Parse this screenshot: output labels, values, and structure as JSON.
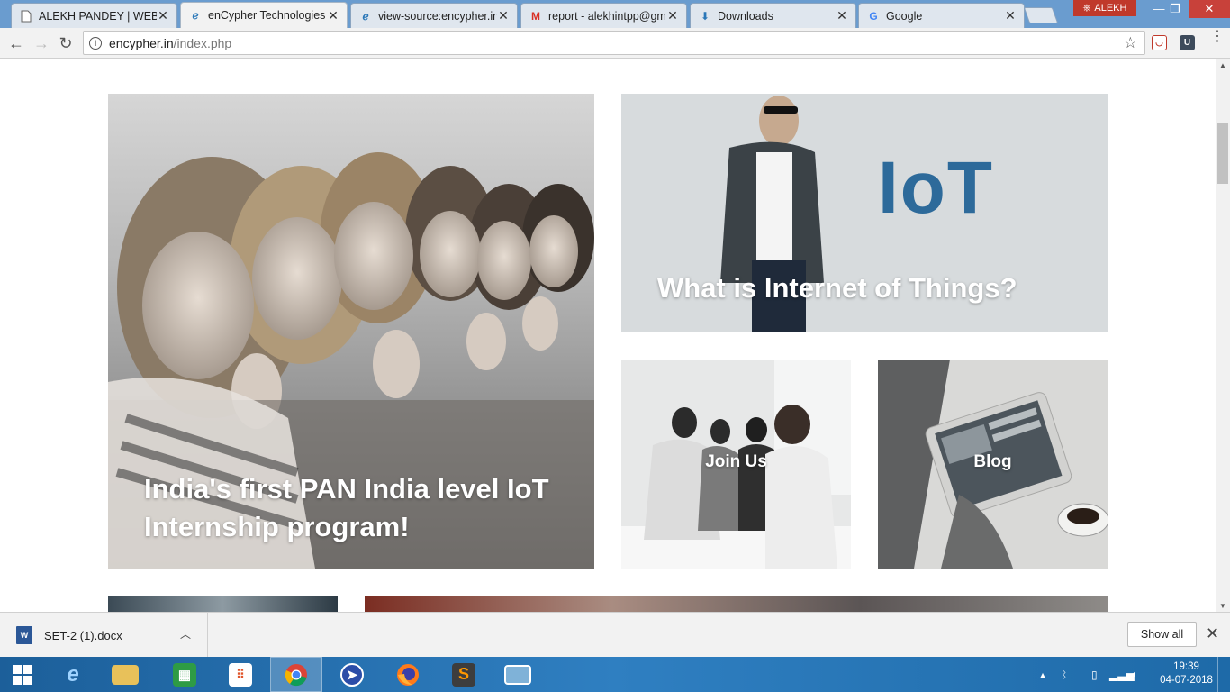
{
  "browser": {
    "tabs": [
      {
        "title": "ALEKH PANDEY | WEB D",
        "icon": "page-icon"
      },
      {
        "title": "enCypher Technologies",
        "icon": "encypher-icon",
        "active": true
      },
      {
        "title": "view-source:encypher.in",
        "icon": "encypher-icon"
      },
      {
        "title": "report - alekhintpp@gm",
        "icon": "gmail-icon"
      },
      {
        "title": "Downloads",
        "icon": "download-icon"
      },
      {
        "title": "Google",
        "icon": "google-icon"
      }
    ],
    "profile_name": "ALEKH",
    "url_host": "encypher.in",
    "url_path": "/index.php"
  },
  "page": {
    "cards": {
      "internship": "India's first PAN India level IoT Internship program!",
      "iot": "What is Internet of Things?",
      "iot_sign": "IoT",
      "join": "Join Us",
      "blog": "Blog"
    }
  },
  "downloads": {
    "file_name": "SET-2 (1).docx",
    "file_type_badge": "W",
    "show_all_label": "Show all"
  },
  "taskbar": {
    "time": "19:39",
    "date": "04-07-2018"
  },
  "colors": {
    "tabstrip": "#6a9ccf",
    "taskbar": "#2f7fc1",
    "close_button": "#c8413a",
    "gmail": "#d93025",
    "sublime": "#ff9800"
  }
}
